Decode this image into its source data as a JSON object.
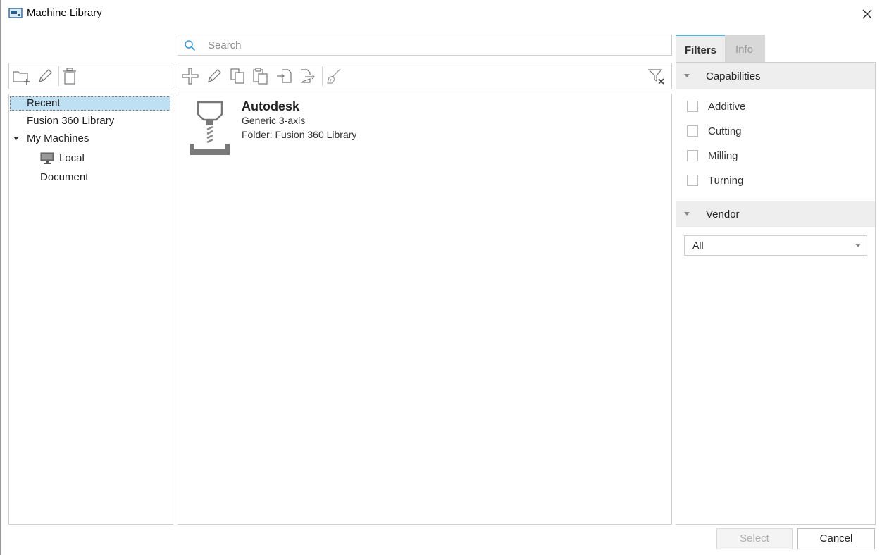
{
  "window": {
    "title": "Machine Library",
    "close_icon": "close-icon",
    "app_icon": "machine-library-icon"
  },
  "search": {
    "placeholder": "Search",
    "value": ""
  },
  "left_toolbar": {
    "icons": [
      "new-folder-icon",
      "rename-pencil-icon",
      "delete-trash-icon"
    ]
  },
  "main_toolbar": {
    "icons": [
      "add-plus-icon",
      "edit-pencil-icon",
      "copy-icon",
      "paste-icon",
      "import-icon",
      "export-icon",
      "clear-brush-icon",
      "clear-filter-icon"
    ]
  },
  "tree": {
    "items": [
      {
        "label": "Recent",
        "selected": true
      },
      {
        "label": "Fusion 360 Library"
      },
      {
        "label": "My Machines",
        "expanded": true
      },
      {
        "label": "Local",
        "icon": "monitor-icon"
      },
      {
        "label": "Document"
      }
    ]
  },
  "machines": [
    {
      "vendor": "Autodesk",
      "description": "Generic 3-axis",
      "folder": "Folder: Fusion 360 Library",
      "icon": "milling-machine-icon"
    }
  ],
  "right_panel": {
    "tabs": [
      {
        "label": "Filters",
        "active": true
      },
      {
        "label": "Info",
        "active": false
      }
    ],
    "capabilities": {
      "header": "Capabilities",
      "options": [
        {
          "label": "Additive",
          "checked": false
        },
        {
          "label": "Cutting",
          "checked": false
        },
        {
          "label": "Milling",
          "checked": false
        },
        {
          "label": "Turning",
          "checked": false
        }
      ]
    },
    "vendor": {
      "header": "Vendor",
      "selected": "All"
    }
  },
  "footer": {
    "select_label": "Select",
    "cancel_label": "Cancel",
    "select_enabled": false
  },
  "colors": {
    "selection": "#bfe0f3",
    "tab_accent": "#5eaedc",
    "search_icon": "#3d9bd4"
  }
}
